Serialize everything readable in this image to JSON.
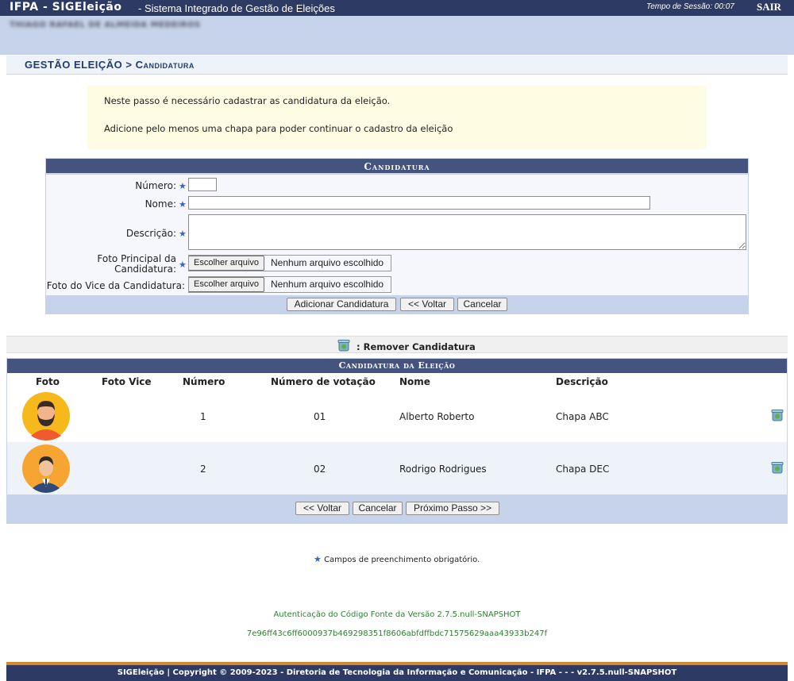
{
  "top": {
    "app_name": "IFPA - SIGEleição",
    "subtitle": "- Sistema Integrado de Gestão de Eleições",
    "session_label": "Tempo de Sessão: 00:07",
    "exit_label": "SAIR"
  },
  "user": {
    "name": "THIAGO RAFAEL DE ALMEIDA MEDEIROS"
  },
  "breadcrumb": {
    "section": "GESTÃO ELEIÇÃO",
    "separator": ">",
    "page": "Candidatura"
  },
  "info": {
    "line1": "Neste passo é necessário cadastrar as candidatura da eleição.",
    "line2": "Adicione pelo menos uma chapa para poder continuar o cadastro da eleição"
  },
  "form": {
    "title": "Candidatura",
    "numero_label": "Número:",
    "nome_label": "Nome:",
    "descricao_label": "Descrição:",
    "foto_principal_label_1": "Foto Principal da",
    "foto_principal_label_2": "Candidatura:",
    "foto_vice_label": "Foto do Vice da Candidatura:",
    "numero_value": "",
    "nome_value": "",
    "descricao_value": "",
    "file_button": "Escolher arquivo",
    "file_status": "Nenhum arquivo escolhido",
    "required_star": "★",
    "add_button": "Adicionar Candidatura",
    "back_button": "<< Voltar",
    "cancel_button": "Cancelar"
  },
  "legend": {
    "text": ": Remover Candidatura"
  },
  "table": {
    "title": "Candidatura da Eleição",
    "columns": [
      "Foto",
      "Foto Vice",
      "Número",
      "Número de votação",
      "Nome",
      "Descrição"
    ],
    "rows": [
      {
        "numero": "1",
        "votacao": "01",
        "nome": "Alberto Roberto",
        "descricao": "Chapa ABC",
        "avatar": "bearded-man-avatar"
      },
      {
        "numero": "2",
        "votacao": "02",
        "nome": "Rodrigo Rodrigues",
        "descricao": "Chapa DEC",
        "avatar": "suited-man-avatar"
      }
    ],
    "back_button": "<< Voltar",
    "cancel_button": "Cancelar",
    "next_button": "Próximo Passo >>"
  },
  "required_note": "Campos de preenchimento obrigatório.",
  "auth": {
    "version": "Autenticação do Código Fonte da Versão 2.7.5.null-SNAPSHOT",
    "hash": "7e96ff43c6ff6000937b469298351f8606abfdffbdc71575629aaa43933b247f"
  },
  "footer": "SIGEleição | Copyright © 2009-2023 - Diretoria de Tecnologia da Informação e Comunicação - IFPA - - - v2.7.5.null-SNAPSHOT",
  "colors": {
    "header": "#2d3a63",
    "panel": "#c6d3ea",
    "accent": "#d98630",
    "info_bg": "#fefde3"
  }
}
